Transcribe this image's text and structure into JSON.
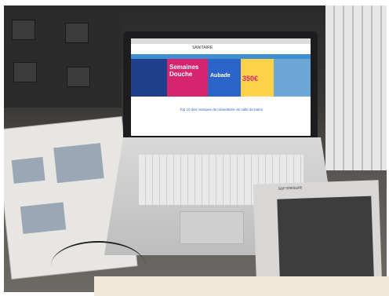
{
  "scene": {
    "laptop_screen": {
      "site_header_text": "SANITAIRE",
      "banner": {
        "left_label": "Semaines",
        "main_label": "Douche",
        "brand_label": "Aubade",
        "price_label": "350€"
      },
      "content_title": "Top 10 des marques de robinetterie de salle de bains"
    },
    "magazine_right": {
      "title": "sur-mesure"
    }
  }
}
